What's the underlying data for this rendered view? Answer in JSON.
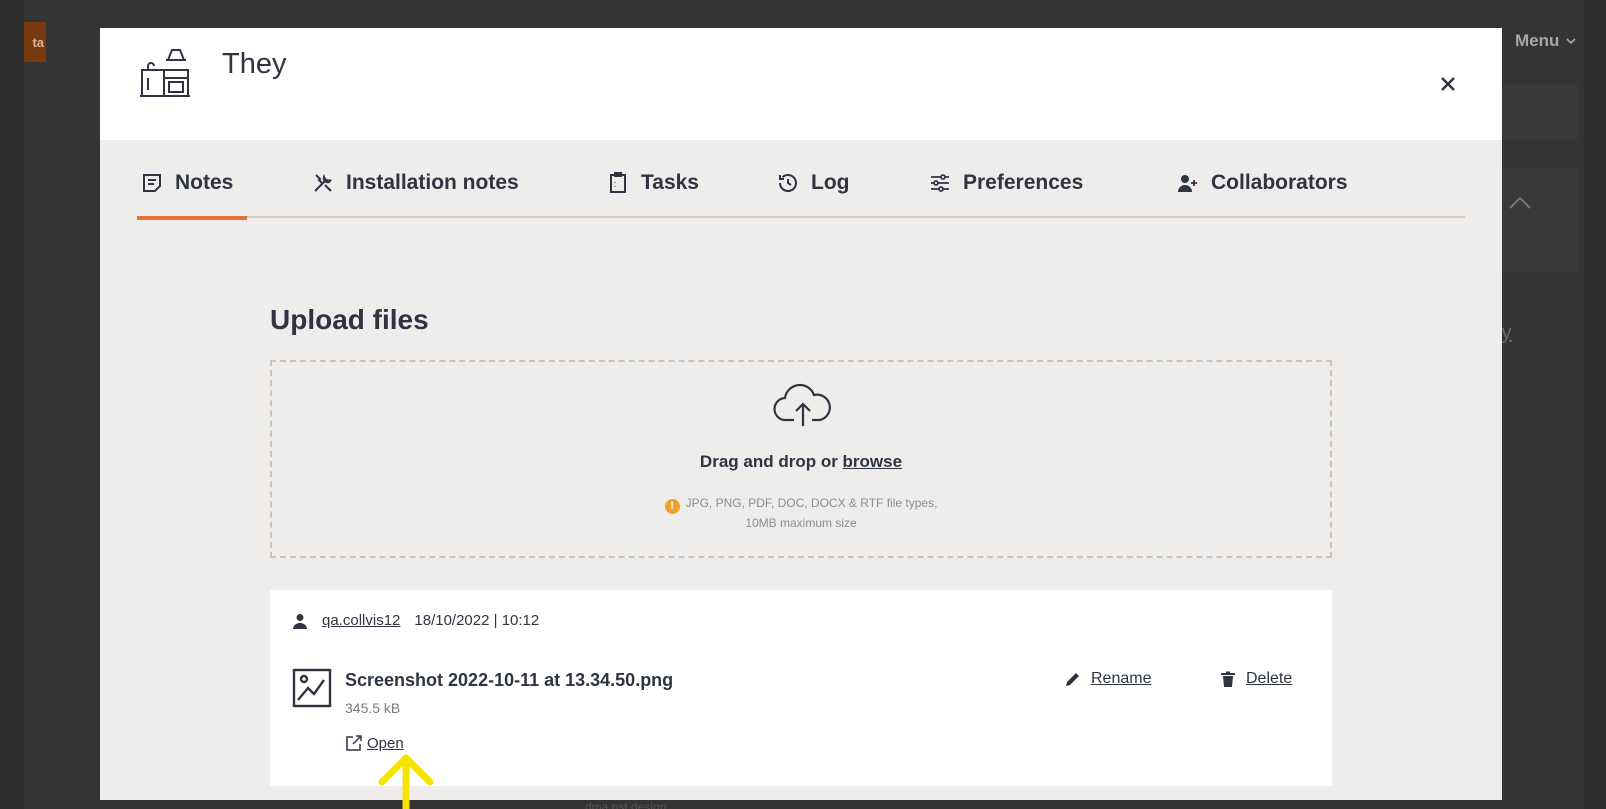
{
  "background": {
    "logo_text": "ta",
    "menu_label": "Menu",
    "partial_link": "ty",
    "bottom_text": "dma.pst.design"
  },
  "modal": {
    "title": "They",
    "close_icon": "close-icon",
    "tabs": [
      {
        "label": "Notes",
        "icon": "notes-icon",
        "active": true
      },
      {
        "label": "Installation notes",
        "icon": "tools-icon",
        "active": false
      },
      {
        "label": "Tasks",
        "icon": "clipboard-icon",
        "active": false
      },
      {
        "label": "Log",
        "icon": "history-icon",
        "active": false
      },
      {
        "label": "Preferences",
        "icon": "sliders-icon",
        "active": false
      },
      {
        "label": "Collaborators",
        "icon": "add-user-icon",
        "active": false
      }
    ],
    "accent_color": "#e8703a"
  },
  "upload": {
    "title": "Upload files",
    "drop_prefix": "Drag and drop or ",
    "browse_label": "browse",
    "file_types": "JPG, PNG, PDF, DOC, DOCX & RTF file types,",
    "max_size": "10MB maximum size"
  },
  "file": {
    "uploader": "qa.collvis12",
    "timestamp": "18/10/2022 | 10:12",
    "name": "Screenshot 2022-10-11 at 13.34.50.png",
    "size": "345.5 kB",
    "rename_label": "Rename",
    "delete_label": "Delete",
    "open_label": "Open"
  },
  "annotation": {
    "arrow_color": "#f5e400"
  }
}
